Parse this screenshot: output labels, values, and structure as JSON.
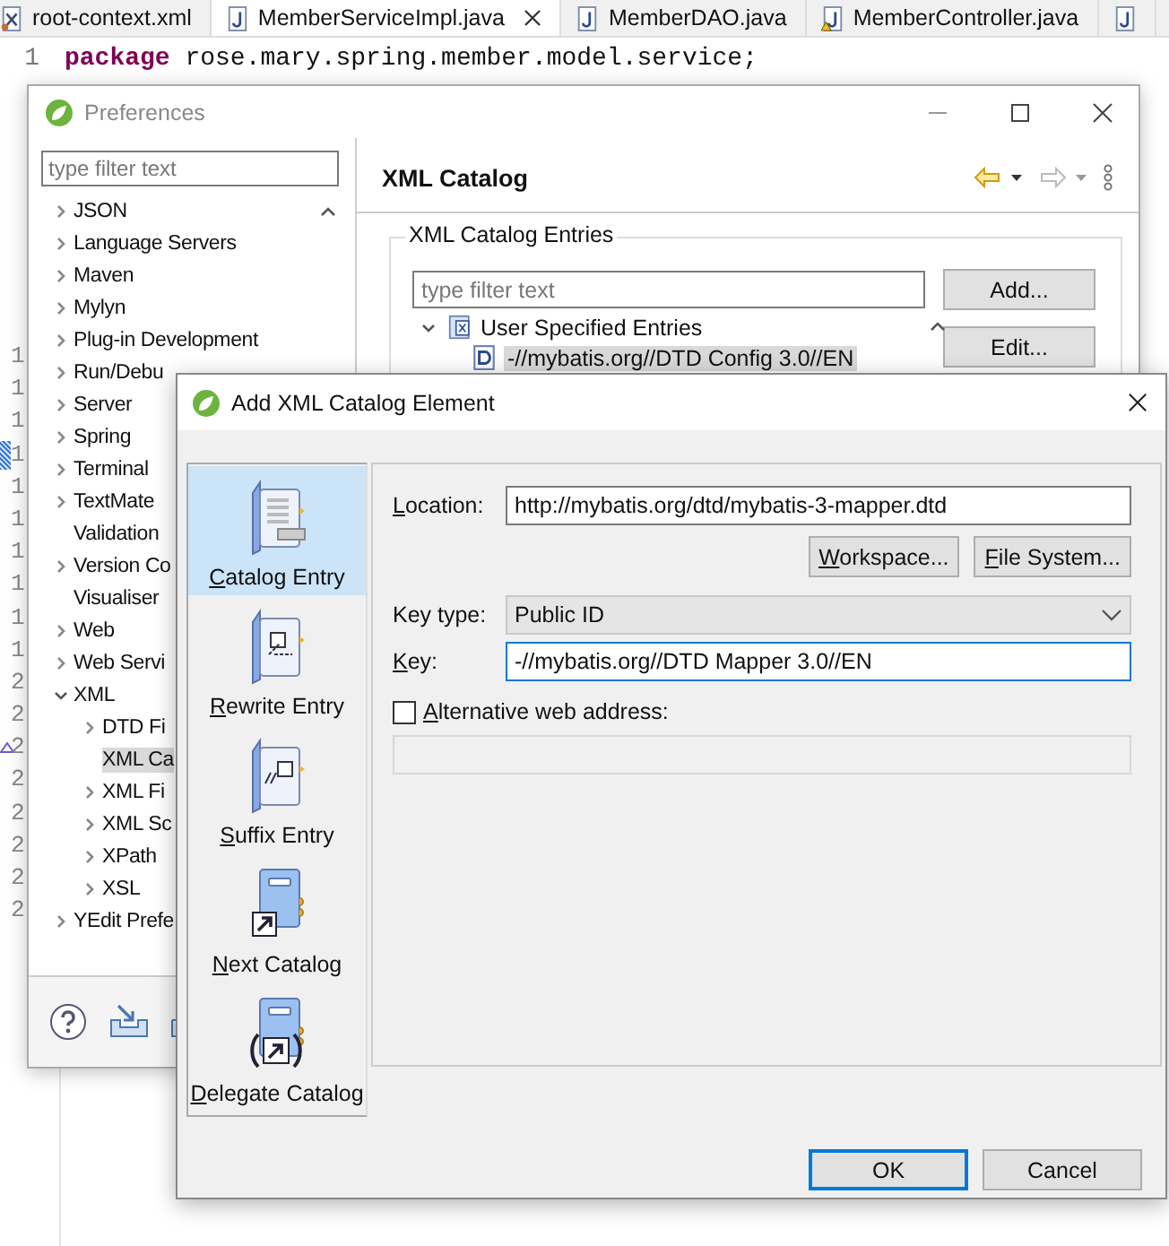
{
  "editor": {
    "tabs": [
      {
        "label": "root-context.xml",
        "kind": "xml",
        "selected": false
      },
      {
        "label": "MemberServiceImpl.java",
        "kind": "java",
        "selected": true
      },
      {
        "label": "MemberDAO.java",
        "kind": "java",
        "selected": false
      },
      {
        "label": "MemberController.java",
        "kind": "java-warning",
        "selected": false
      },
      {
        "kind": "java",
        "selected": false
      }
    ],
    "first_line": {
      "number": "1",
      "code": "**package** rose.mary.spring.member.model.service;"
    },
    "gutter_fragments": [
      {
        "text": "1",
        "kind": "plain"
      },
      {
        "text": "1",
        "kind": "plain"
      },
      {
        "text": "1",
        "kind": "plain"
      },
      {
        "text": "1",
        "kind": "highlight"
      },
      {
        "text": "1",
        "kind": "plain"
      },
      {
        "text": "1",
        "kind": "plain"
      },
      {
        "text": "1",
        "kind": "plain"
      },
      {
        "text": "1",
        "kind": "plain"
      },
      {
        "text": "1",
        "kind": "plain"
      },
      {
        "text": "1",
        "kind": "plain"
      },
      {
        "text": "2",
        "kind": "plain"
      },
      {
        "text": "2",
        "kind": "plain"
      },
      {
        "text": "2",
        "kind": "override"
      },
      {
        "text": "2",
        "kind": "plain"
      },
      {
        "text": "2",
        "kind": "plain"
      },
      {
        "text": "2",
        "kind": "plain"
      },
      {
        "text": "2",
        "kind": "plain"
      },
      {
        "text": "2",
        "kind": "plain"
      }
    ]
  },
  "preferences": {
    "title": "Preferences",
    "filter_placeholder": "type filter text",
    "tree": [
      {
        "label": "JSON",
        "expanded": false,
        "selected": false
      },
      {
        "label": "Language Servers",
        "expanded": false,
        "selected": false
      },
      {
        "label": "Maven",
        "expanded": false,
        "selected": false
      },
      {
        "label": "Mylyn",
        "expanded": false,
        "selected": false
      },
      {
        "label": "Plug-in Development",
        "expanded": false,
        "selected": false
      },
      {
        "label": "Run/Debu",
        "expanded": false,
        "selected": false
      },
      {
        "label": "Server",
        "expanded": false,
        "selected": false
      },
      {
        "label": "Spring",
        "expanded": false,
        "selected": false
      },
      {
        "label": "Terminal",
        "expanded": false,
        "selected": false
      },
      {
        "label": "TextMate",
        "expanded": false,
        "selected": false
      },
      {
        "label": "Validation",
        "selected": false
      },
      {
        "label": "Version Co",
        "expanded": false,
        "selected": false
      },
      {
        "label": "Visualiser",
        "selected": false
      },
      {
        "label": "Web",
        "expanded": false,
        "selected": false
      },
      {
        "label": "Web Servi",
        "expanded": false,
        "selected": false
      },
      {
        "label": "XML",
        "expanded": true,
        "selected": false,
        "children": [
          {
            "label": "DTD Fi",
            "expanded": false,
            "selected": false
          },
          {
            "label": "XML Ca",
            "selected": true
          },
          {
            "label": "XML Fi",
            "expanded": false,
            "selected": false
          },
          {
            "label": "XML Sc",
            "expanded": false,
            "selected": false
          },
          {
            "label": "XPath",
            "expanded": false,
            "selected": false
          },
          {
            "label": "XSL",
            "expanded": false,
            "selected": false
          }
        ]
      },
      {
        "label": "YEdit Prefe",
        "expanded": false,
        "selected": false
      }
    ],
    "page_title": "XML Catalog",
    "group_title": "XML Catalog Entries",
    "entries_filter_placeholder": "type filter text",
    "entries": [
      {
        "label": "User Specified Entries",
        "expanded": true,
        "children": [
          {
            "label": "-//mybatis.org//DTD Config 3.0//EN",
            "selected": true
          }
        ]
      }
    ],
    "buttons": [
      "Add...",
      "Edit..."
    ]
  },
  "dialog": {
    "title": "Add XML Catalog Element",
    "entry_types": [
      {
        "label": "Catalog Entry",
        "kind": "catalog",
        "selected": true
      },
      {
        "label": "Rewrite Entry",
        "kind": "rewrite",
        "selected": false
      },
      {
        "label": "Suffix Entry",
        "kind": "suffix",
        "selected": false
      },
      {
        "label": "Next Catalog",
        "kind": "next",
        "selected": false
      },
      {
        "label": "Delegate Catalog",
        "kind": "delegate",
        "selected": false
      }
    ],
    "location": {
      "label": "Location:",
      "value": "http://mybatis.org/dtd/mybatis-3-mapper.dtd"
    },
    "browse_buttons": [
      "Workspace...",
      "File System..."
    ],
    "key_type": {
      "label": "Key type:",
      "value": "Public ID"
    },
    "key": {
      "label": "Key:",
      "value": "-//mybatis.org//DTD Mapper 3.0//EN",
      "focused": true
    },
    "alternative": {
      "label": "Alternative web address:",
      "checked": false
    },
    "alternative_field": {
      "disabled": true
    },
    "buttons": [
      {
        "label": "OK",
        "default": true
      },
      {
        "label": "Cancel",
        "default": false
      }
    ]
  }
}
